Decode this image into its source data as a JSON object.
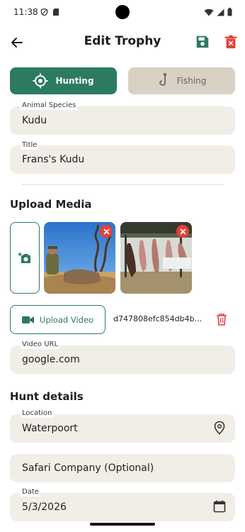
{
  "status": {
    "time": "11:38"
  },
  "app_bar": {
    "title": "Edit Trophy"
  },
  "segments": {
    "hunting": "Hunting",
    "fishing": "Fishing",
    "selected": "hunting"
  },
  "form": {
    "animal_species": {
      "label": "Animal Species",
      "value": "Kudu"
    },
    "title": {
      "label": "Title",
      "value": "Frans's Kudu"
    }
  },
  "media": {
    "section_title": "Upload Media",
    "upload_video_label": "Upload Video",
    "video_filename": "d747808efc854db4b...",
    "video_url": {
      "label": "Video URL",
      "value": "google.com"
    }
  },
  "hunt": {
    "section_title": "Hunt details",
    "location": {
      "label": "Location",
      "value": "Waterpoort"
    },
    "safari_company": {
      "value": "Safari Company (Optional)"
    },
    "date": {
      "label": "Date",
      "value": "5/3/2026"
    }
  },
  "colors": {
    "accent": "#2c7a61",
    "danger": "#e5403a",
    "field_bg": "#f1ede7",
    "segment_inactive": "#d8d1c4"
  }
}
